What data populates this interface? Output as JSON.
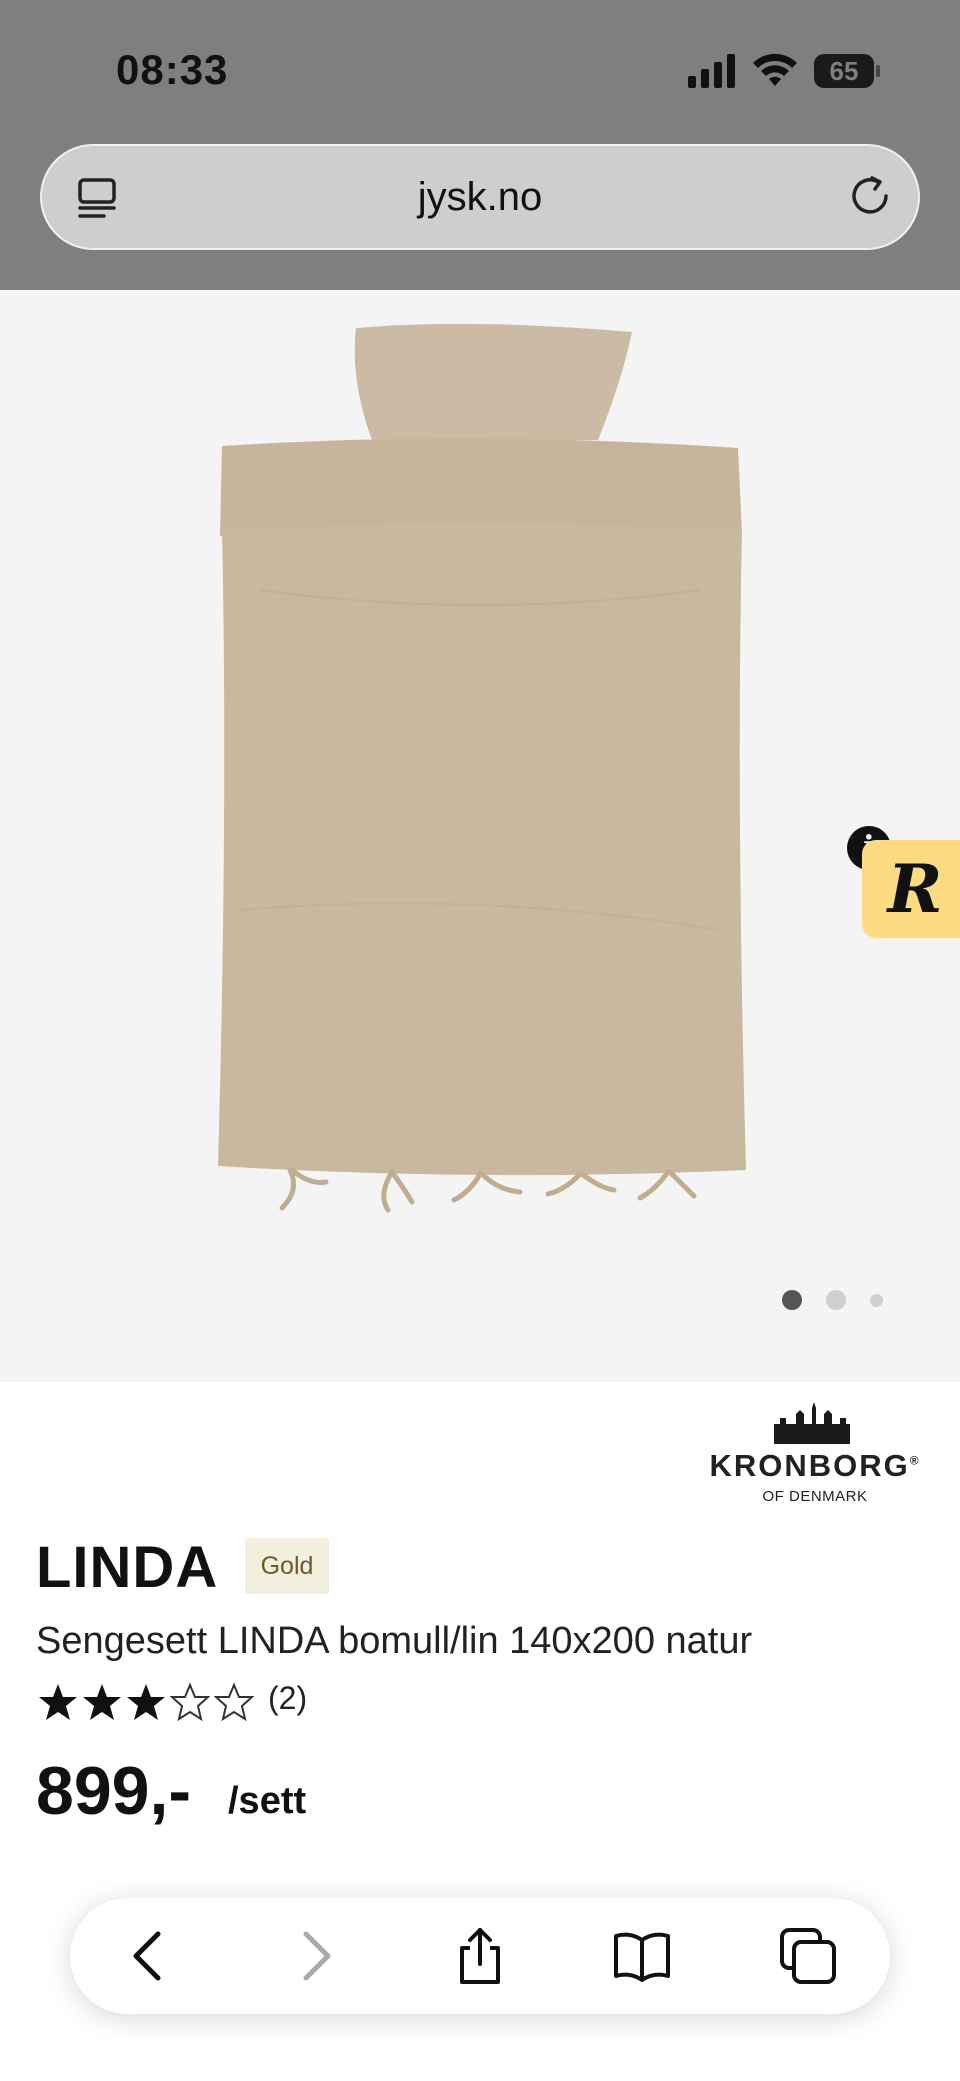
{
  "status_bar": {
    "time": "08:33",
    "battery_level": "65"
  },
  "browser": {
    "url": "jysk.no"
  },
  "gallery": {
    "image": "duvet-cover-set-photo",
    "slide_count": 3,
    "active_slide": 1
  },
  "brand": {
    "name": "KRONBORG",
    "registered_mark": "®",
    "sub": "OF DENMARK"
  },
  "product": {
    "title": "LINDA",
    "tier_badge": "Gold",
    "subtitle": "Sengesett LINDA bomull/lin 140x200 natur",
    "rating": 3,
    "rating_max": 5,
    "rating_count": "(2)",
    "price": "899,-",
    "unit": "/sett"
  },
  "colors": {
    "accent_badge": "#fddb80",
    "tier_badge_bg": "#f3efdf",
    "fabric": "#c9b8a0"
  },
  "toolbar": {
    "icons": [
      "back-icon",
      "forward-icon",
      "share-icon",
      "bookmarks-icon",
      "tabs-icon"
    ]
  }
}
